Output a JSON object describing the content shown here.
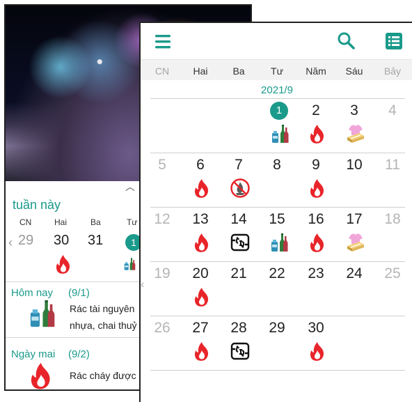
{
  "back_screen": {
    "week_title": "tuần này",
    "week_headers": [
      "CN",
      "Hai",
      "Ba",
      "Tư"
    ],
    "week_days": [
      "29",
      "30",
      "31"
    ],
    "today_number": "1",
    "today": {
      "label": "Hôm nay",
      "date": "(9/1)",
      "desc_line1": "Rác tài nguyên",
      "desc_line2": "nhựa, chai thuỷ"
    },
    "tomorrow": {
      "label": "Ngày mai",
      "date": "(9/2)",
      "desc_line1": "Rác cháy được"
    }
  },
  "calendar": {
    "toolbar": {
      "menu_icon": "menu-icon",
      "search_icon": "search-icon",
      "list_icon": "list-icon"
    },
    "weekdays": [
      "CN",
      "Hai",
      "Ba",
      "Tư",
      "Năm",
      "Sáu",
      "Bảy"
    ],
    "month_label": "2021/9",
    "weeks": [
      [
        "",
        "",
        "",
        "1",
        "2",
        "3",
        "4"
      ],
      [
        "5",
        "6",
        "7",
        "8",
        "9",
        "10",
        "11"
      ],
      [
        "12",
        "13",
        "14",
        "15",
        "16",
        "17",
        "18"
      ],
      [
        "19",
        "20",
        "21",
        "22",
        "23",
        "24",
        "25"
      ],
      [
        "26",
        "27",
        "28",
        "29",
        "30",
        "",
        ""
      ]
    ],
    "colors": {
      "accent": "#1a9a8a",
      "burnable": "#e8252a",
      "muted": "#b5b5b5"
    },
    "icon_legend": {
      "burnable": "flame-icon",
      "resource": "bottles-icon",
      "old_clothes": "clothes-icon",
      "not_burnable": "no-burn-icon",
      "recyclable": "recycle-icon"
    }
  }
}
